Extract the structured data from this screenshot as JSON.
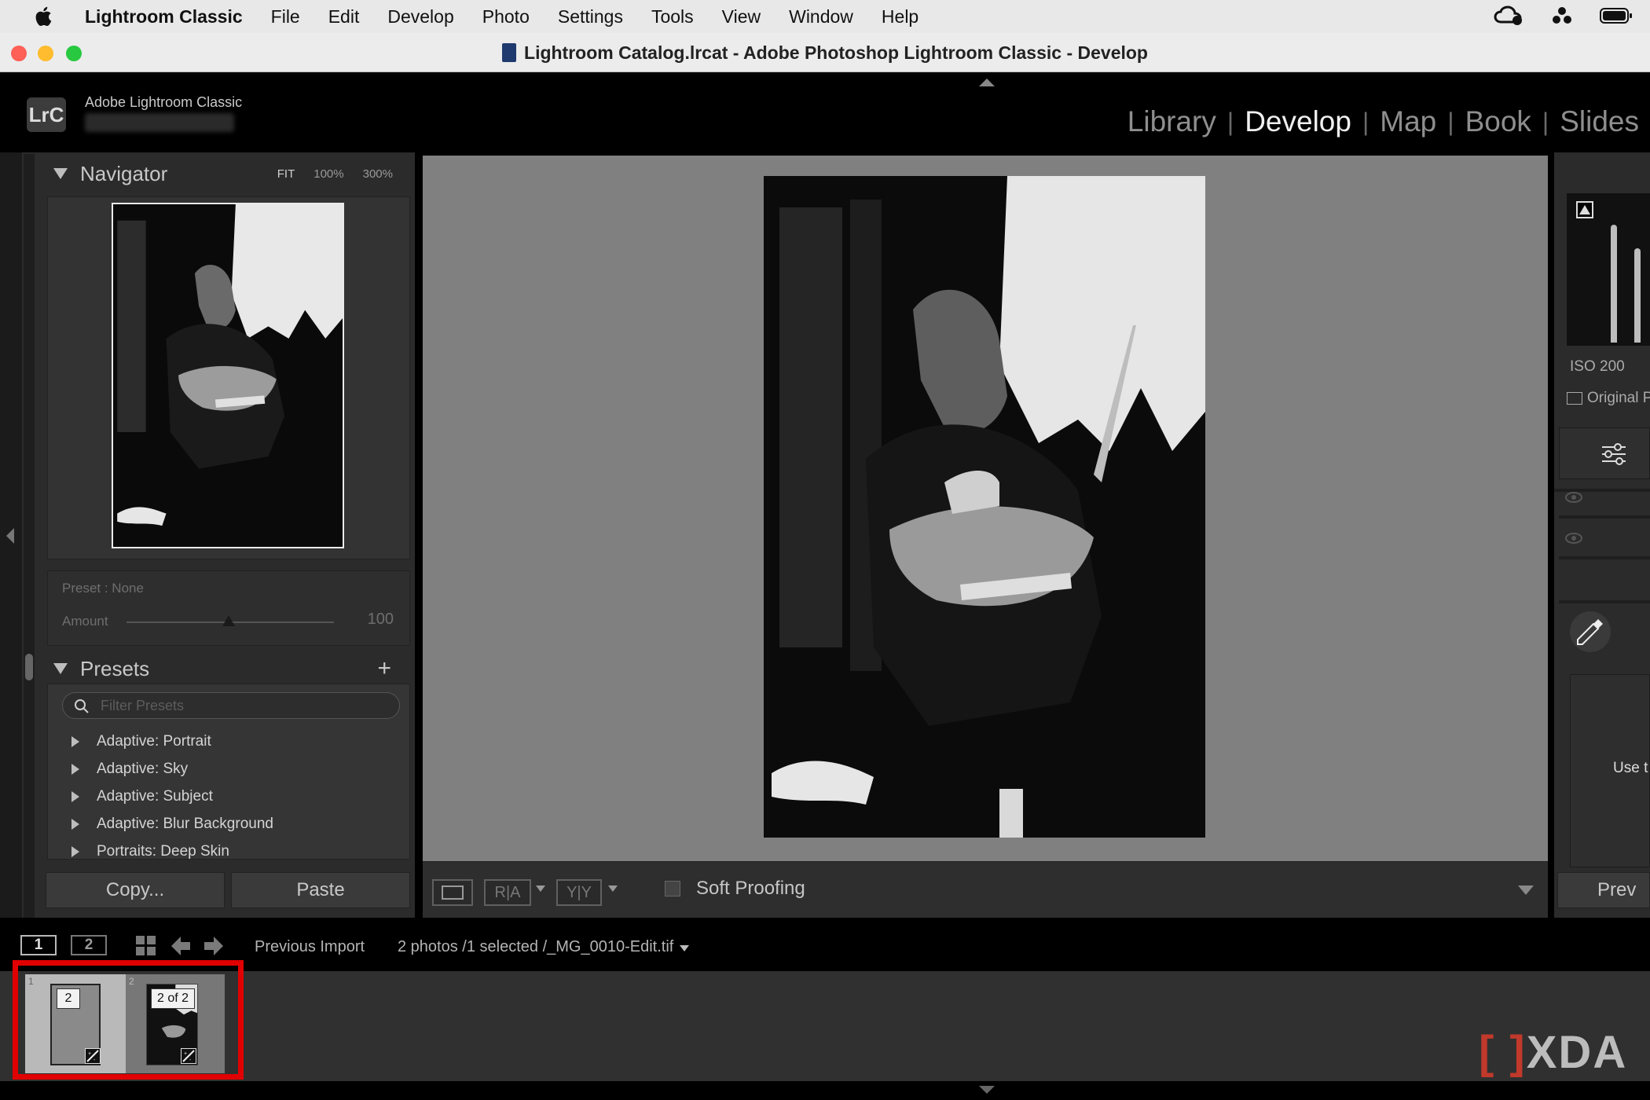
{
  "menubar": {
    "app_name": "Lightroom Classic",
    "items": [
      "File",
      "Edit",
      "Develop",
      "Photo",
      "Settings",
      "Tools",
      "View",
      "Window",
      "Help"
    ]
  },
  "window": {
    "title": "Lightroom Catalog.lrcat - Adobe Photoshop Lightroom Classic - Develop"
  },
  "identity": {
    "logo": "LrC",
    "app_label": "Adobe Lightroom Classic"
  },
  "modules": [
    "Library",
    "Develop",
    "Map",
    "Book",
    "Slides"
  ],
  "active_module": "Develop",
  "navigator": {
    "title": "Navigator",
    "zoom_fit": "FIT",
    "zoom_100": "100%",
    "zoom_300": "300%"
  },
  "preset_amount": {
    "preset_label": "Preset : None",
    "amount_label": "Amount",
    "amount_value": "100"
  },
  "presets": {
    "title": "Presets",
    "filter_placeholder": "Filter Presets",
    "items": [
      "Adaptive: Portrait",
      "Adaptive: Sky",
      "Adaptive: Subject",
      "Adaptive: Blur Background",
      "Portraits: Deep Skin"
    ]
  },
  "buttons": {
    "copy": "Copy...",
    "paste": "Paste"
  },
  "toolbar": {
    "soft_proofing": "Soft Proofing",
    "before_after_1": "R|A",
    "before_after_2": "Y|Y"
  },
  "right_panel": {
    "iso": "ISO 200",
    "original_label": "Original P",
    "use_label": "Use t",
    "prev_label": "Prev"
  },
  "filmstrip": {
    "screen1": "1",
    "screen2": "2",
    "source": "Previous Import",
    "selection": "2 photos /1 selected /_MG_0010-Edit.tif",
    "thumb1_index": "1",
    "thumb1_badge": "2",
    "thumb2_index": "2",
    "thumb2_badge": "2 of 2"
  },
  "watermark": "XDA"
}
